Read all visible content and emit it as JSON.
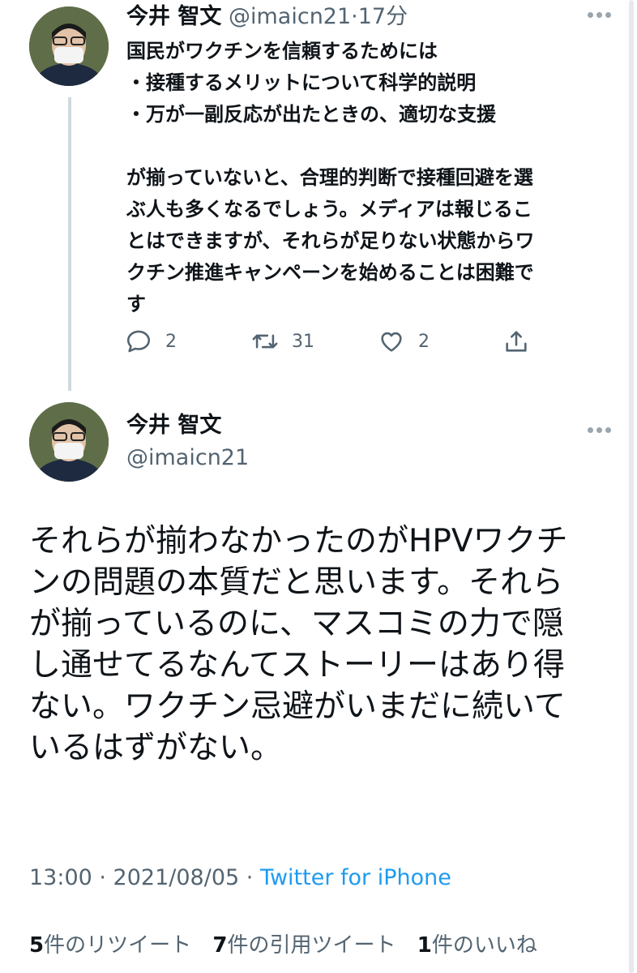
{
  "tweet1": {
    "author_name": "今井 智文",
    "handle": "@imaicn21",
    "time": "·17分",
    "lines": [
      "国民がワクチンを信頼するためには",
      "・接種するメリットについて科学的説明",
      "・万が一副反応が出たときの、適切な支援",
      "",
      "が揃っていないと、合理的判断で接種回避を選",
      "ぶ人も多くなるでしょう。メディアは報じるこ",
      "とはできますが、それらが足りない状態からワ",
      "クチン推進キャンペーンを始めることは困難で",
      "す"
    ],
    "reply_count": "2",
    "retweet_count": "31",
    "like_count": "2"
  },
  "tweet2": {
    "author_name": "今井 智文",
    "handle": "@imaicn21",
    "lines": [
      "それらが揃わなかったのがHPVワクチ",
      "ンの問題の本質だと思います。それら",
      "が揃っているのに、マスコミの力で隠",
      "し通せてるなんてストーリーはあり得",
      "ない。ワクチン忌避がいまだに続いて",
      "いるはずがない。"
    ],
    "timestamp": "13:00 · 2021/08/05 · ",
    "source": "Twitter for iPhone",
    "stats": {
      "retweets_num": "5",
      "retweets_label": "件のリツイート",
      "quotes_num": "7",
      "quotes_label": "件の引用ツイート",
      "likes_num": "1",
      "likes_label": "件のいいね"
    }
  },
  "icons": [
    "more-icon",
    "reply-icon",
    "retweet-icon",
    "like-icon",
    "share-icon"
  ],
  "colors": {
    "text": "#0f1419",
    "muted": "#536471",
    "link": "#1d9bf0",
    "line": "#cfd9de"
  }
}
